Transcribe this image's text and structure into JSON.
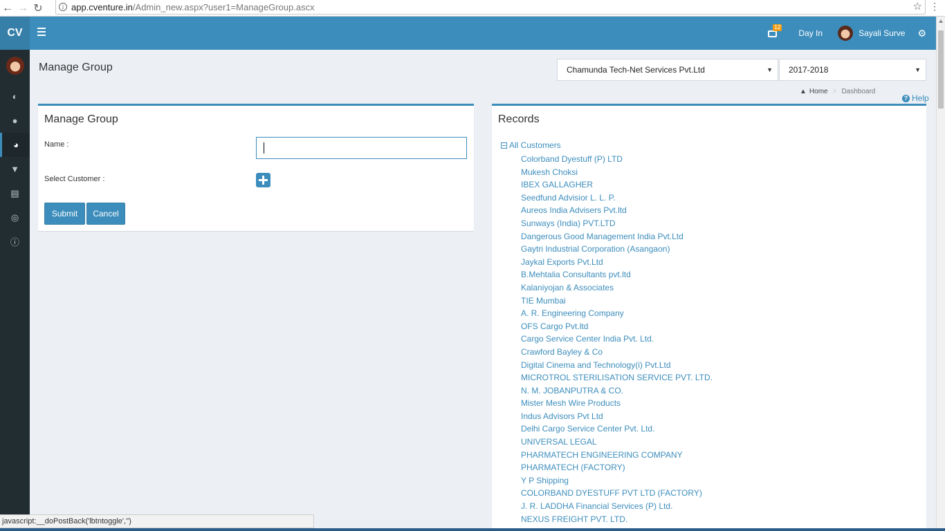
{
  "browser": {
    "url_host": "app.cventure.in",
    "url_path": "/Admin_new.aspx?user1=ManageGroup.ascx"
  },
  "header": {
    "logo": "CV",
    "notification_count": "12",
    "day_in_label": "Day In",
    "user_name": "Sayali Surve"
  },
  "sidebar": {
    "items": [
      {
        "icon": "dashboard-icon"
      },
      {
        "icon": "user-icon"
      },
      {
        "icon": "pie-chart-icon",
        "active": true
      },
      {
        "icon": "shopping-cart-icon"
      },
      {
        "icon": "credit-card-icon"
      },
      {
        "icon": "globe-icon"
      },
      {
        "icon": "info-icon"
      }
    ]
  },
  "page": {
    "title": "Manage Group",
    "company_select": "Chamunda Tech-Net Services Pvt.Ltd",
    "year_select": "2017-2018",
    "breadcrumb": {
      "home": "Home",
      "current": "Dashboard"
    },
    "help_label": "Help"
  },
  "form": {
    "title": "Manage Group",
    "name_label": "Name :",
    "name_value": "",
    "customer_label": "Select Customer :",
    "submit_label": "Submit",
    "cancel_label": "Cancel"
  },
  "records": {
    "title": "Records",
    "root_label": "All Customers",
    "customers": [
      "Colorband Dyestuff (P) LTD",
      "Mukesh Choksi",
      "IBEX GALLAGHER",
      "Seedfund Advisior L. L. P.",
      "Aureos India Advisers Pvt.ltd",
      "Sunways (India) PVT.LTD",
      "Dangerous Good Management India Pvt.Ltd",
      "Gaytri Industrial Corporation (Asangaon)",
      "Jaykal Exports Pvt.Ltd",
      "B.Mehtalia Consultants pvt.ltd",
      "Kalaniyojan & Associates",
      "TIE Mumbai",
      "A. R. Engineering Company",
      "OFS Cargo Pvt.ltd",
      "Cargo Service Center India Pvt. Ltd.",
      "Crawford Bayley & Co",
      "Digital Cinema and Technology(i) Pvt.Ltd",
      "MICROTROL STERILISATION SERVICE PVT. LTD.",
      "N. M. JOBANPUTRA & CO.",
      "Mister Mesh Wire Products",
      "Indus Advisors Pvt Ltd",
      "Delhi Cargo Service Center Pvt. Ltd.",
      "UNIVERSAL LEGAL",
      "PHARMATECH ENGINEERING COMPANY",
      "PHARMATECH (FACTORY)",
      "Y P Shipping",
      "COLORBAND DYESTUFF PVT LTD (FACTORY)",
      "J. R. LADDHA Financial Services (P) Ltd.",
      "NEXUS FREIGHT PVT. LTD."
    ]
  },
  "status_bar": "javascript:__doPostBack('lbtntoggle','')"
}
